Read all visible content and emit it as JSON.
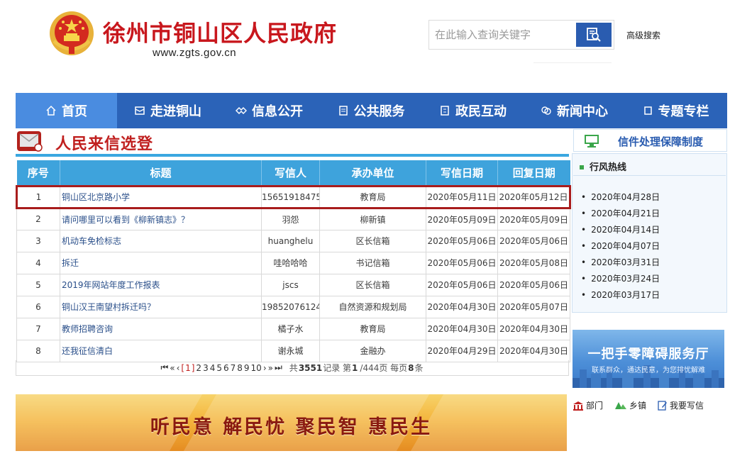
{
  "header": {
    "site_title": "徐州市铜山区人民政府",
    "site_url": "www.zgts.gov.cn",
    "search_placeholder": "在此输入查询关键字",
    "advanced_search": "高级搜索"
  },
  "nav": {
    "items": [
      {
        "label": "首页",
        "icon": "home-icon"
      },
      {
        "label": "走进铜山",
        "icon": "mail-icon"
      },
      {
        "label": "信息公开",
        "icon": "handshake-icon"
      },
      {
        "label": "公共服务",
        "icon": "document-icon"
      },
      {
        "label": "政民互动",
        "icon": "clipboard-icon"
      },
      {
        "label": "新闻中心",
        "icon": "chat-icon"
      },
      {
        "label": "专题专栏",
        "icon": "square-icon"
      }
    ],
    "active_index": 0
  },
  "letters": {
    "section_title": "人民来信选登",
    "columns": [
      "序号",
      "标题",
      "写信人",
      "承办单位",
      "写信日期",
      "回复日期"
    ],
    "rows": [
      {
        "no": "1",
        "title": "铜山区北京路小学",
        "writer": "15651918475",
        "unit": "教育局",
        "sent": "2020年05月11日",
        "replied": "2020年05月12日"
      },
      {
        "no": "2",
        "title": "请问哪里可以看到《柳新镇志》？",
        "writer": "羽怨",
        "unit": "柳新镇",
        "sent": "2020年05月09日",
        "replied": "2020年05月09日"
      },
      {
        "no": "3",
        "title": "机动车免检标志",
        "writer": "huanghelu",
        "unit": "区长信箱",
        "sent": "2020年05月06日",
        "replied": "2020年05月06日"
      },
      {
        "no": "4",
        "title": "拆迁",
        "writer": "哇哈哈哈",
        "unit": "书记信箱",
        "sent": "2020年05月06日",
        "replied": "2020年05月08日"
      },
      {
        "no": "5",
        "title": "2019年网站年度工作报表",
        "writer": "jscs",
        "unit": "区长信箱",
        "sent": "2020年05月06日",
        "replied": "2020年05月06日"
      },
      {
        "no": "6",
        "title": "铜山汉王南望村拆迁吗？",
        "writer": "19852076124",
        "unit": "自然资源和规划局",
        "sent": "2020年04月30日",
        "replied": "2020年05月07日"
      },
      {
        "no": "7",
        "title": "教师招聘咨询",
        "writer": "橘子水",
        "unit": "教育局",
        "sent": "2020年04月30日",
        "replied": "2020年04月30日"
      },
      {
        "no": "8",
        "title": "还我征信清白",
        "writer": "谢永城",
        "unit": "金融办",
        "sent": "2020年04月29日",
        "replied": "2020年04月30日"
      }
    ],
    "highlighted_row": 0
  },
  "pager": {
    "first": "⏮",
    "prev_group": "«",
    "prev": "‹",
    "current": "1",
    "pages": [
      "2",
      "3",
      "4",
      "5",
      "6",
      "7",
      "8",
      "9",
      "10"
    ],
    "next": "›",
    "next_group": "»",
    "last": "⏭",
    "total_text_prefix": "共",
    "total_records": "3551",
    "total_text_mid": "记录 第",
    "current_page": "1",
    "total_pages_text": "/444页 每页",
    "per_page": "8",
    "per_page_suffix": "条"
  },
  "banner": {
    "text": "听民意 解民忧 聚民智 惠民生"
  },
  "sidebar": {
    "guarantee_label": "信件处理保障制度",
    "hotline_title": "行风热线",
    "hotline_dates": [
      "2020年04月28日",
      "2020年04月21日",
      "2020年04月14日",
      "2020年04月07日",
      "2020年03月31日",
      "2020年03月24日",
      "2020年03月17日"
    ],
    "service_title": "一把手零障碍服务厅",
    "service_subtitle": "联系群众，通达民意，为您排忧解难",
    "quick_links": [
      "部门",
      "乡镇",
      "我要写信"
    ]
  },
  "colors": {
    "brand_red": "#c8171d",
    "nav_blue": "#2b63b8",
    "nav_active": "#4a8ce0",
    "table_header": "#3ea3dc",
    "highlight_border": "#a81c1c"
  }
}
